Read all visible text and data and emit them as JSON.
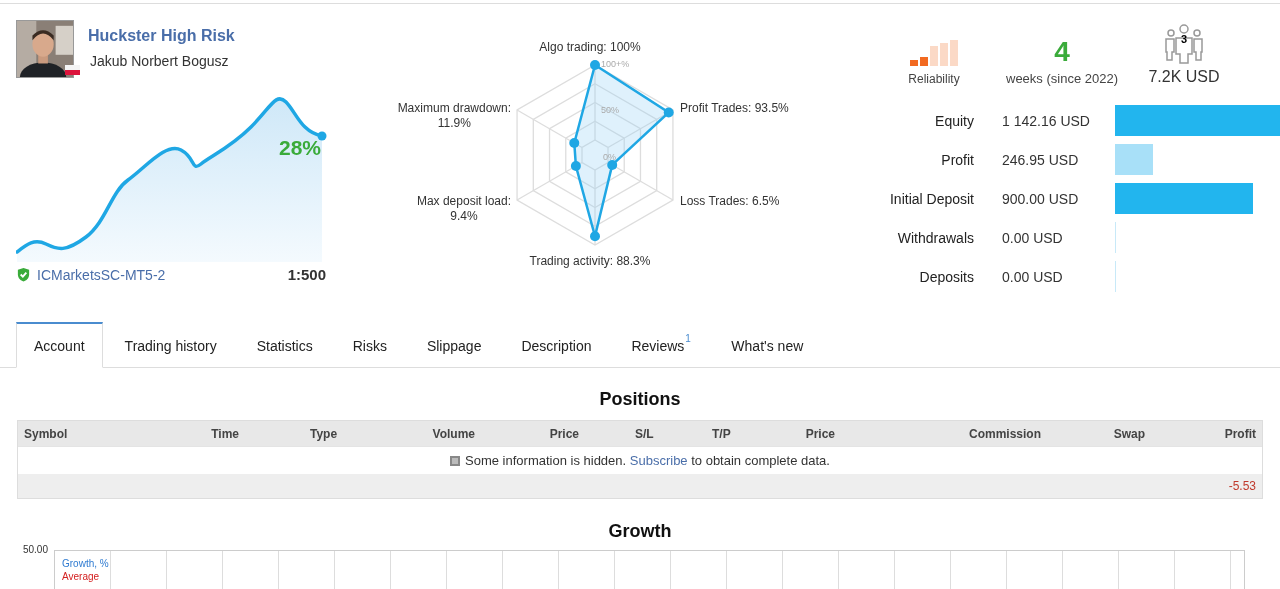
{
  "profile": {
    "name": "Huckster High Risk",
    "author": "Jakub Norbert Bogusz",
    "growth": "28%",
    "server": "ICMarketsSC-MT5-2",
    "server_verified": true,
    "leverage": "1:500"
  },
  "radar": {
    "ticks": [
      "100+%",
      "50%",
      "0%"
    ],
    "axes": [
      {
        "label": "Algo trading:",
        "value": "100%"
      },
      {
        "label": "Maximum drawdown:",
        "value": "11.9%"
      },
      {
        "label": "Profit Trades:",
        "value": "93.5%"
      },
      {
        "label": "Max deposit load:",
        "value": "9.4%"
      },
      {
        "label": "Loss Trades:",
        "value": "6.5%"
      },
      {
        "label": "Trading activity:",
        "value": "88.3%"
      }
    ]
  },
  "summary": {
    "reliability": "Reliability",
    "weeks": "4",
    "weeks_label": "weeks (since 2022)",
    "subscribers": "3",
    "funds": "7.2K USD"
  },
  "balances": [
    {
      "label": "Equity",
      "value": "1 142.16 USD",
      "color": "#22b5ee"
    },
    {
      "label": "Profit",
      "value": "246.95 USD",
      "color": "#a8e0f8"
    },
    {
      "label": "Initial Deposit",
      "value": "900.00 USD",
      "color": "#22b5ee"
    },
    {
      "label": "Withdrawals",
      "value": "0.00 USD",
      "color": "#c8e9f8"
    },
    {
      "label": "Deposits",
      "value": "0.00 USD",
      "color": "#c8e9f8"
    }
  ],
  "tabs": [
    {
      "label": "Account",
      "selected": true
    },
    {
      "label": "Trading history",
      "selected": false
    },
    {
      "label": "Statistics",
      "selected": false
    },
    {
      "label": "Risks",
      "selected": false
    },
    {
      "label": "Slippage",
      "selected": false
    },
    {
      "label": "Description",
      "selected": false
    },
    {
      "label": "Reviews",
      "selected": false,
      "badge": "1"
    },
    {
      "label": "What's new",
      "selected": false
    }
  ],
  "positions": {
    "title": "Positions",
    "columns": [
      "Symbol",
      "Time",
      "Type",
      "Volume",
      "Price",
      "S/L",
      "T/P",
      "Price",
      "Commission",
      "Swap",
      "Profit"
    ],
    "notice": {
      "before": "Some information is hidden.",
      "link": "Subscribe",
      "after": "to obtain complete data."
    },
    "total_profit": "-5.53"
  },
  "growth": {
    "title": "Growth",
    "y_tick": "50.00",
    "legend": [
      {
        "name": "Growth, %"
      },
      {
        "name": "Average"
      }
    ]
  }
}
